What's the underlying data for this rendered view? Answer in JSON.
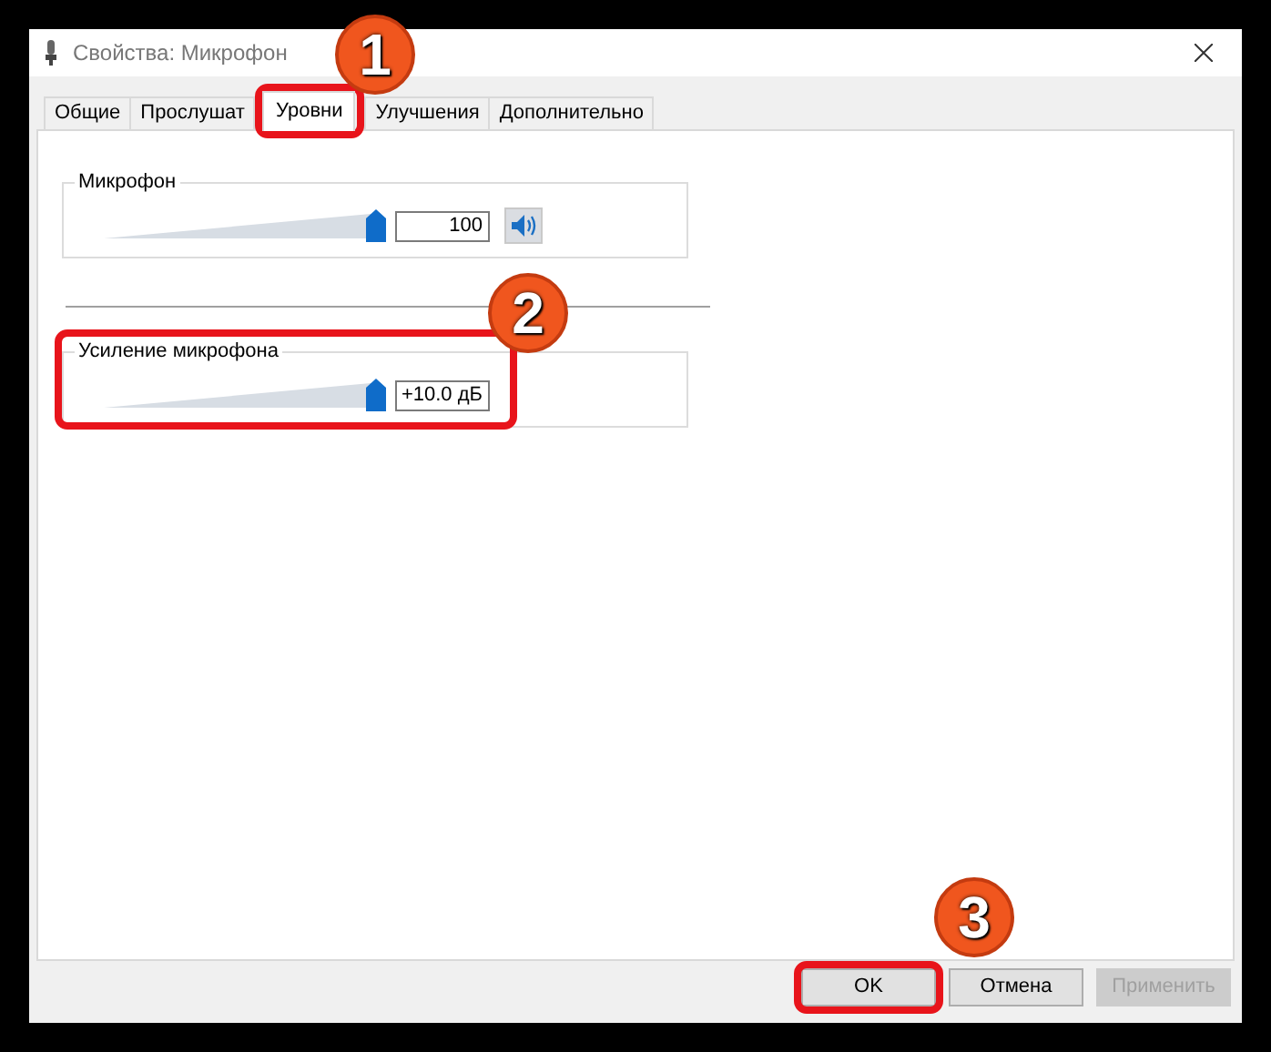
{
  "window": {
    "title": "Свойства: Микрофон"
  },
  "tabs": [
    {
      "label": "Общие",
      "selected": false
    },
    {
      "label": "Прослушат",
      "selected": false
    },
    {
      "label": "Уровни",
      "selected": true
    },
    {
      "label": "Улучшения",
      "selected": false
    },
    {
      "label": "Дополнительно",
      "selected": false
    }
  ],
  "levels": [
    {
      "label": "Микрофон",
      "level": 1.0,
      "reading": "100",
      "muted": false
    },
    {
      "label": "Усиление микрофона",
      "level": 1.0,
      "reading": "+10.0 дБ"
    }
  ],
  "buttons": [
    {
      "label": "OK",
      "disabled": false
    },
    {
      "label": "Отмена",
      "disabled": false
    },
    {
      "label": "Применить",
      "disabled": true
    }
  ],
  "annotations": [
    {
      "label": "1"
    },
    {
      "label": "2"
    },
    {
      "label": "3"
    }
  ]
}
